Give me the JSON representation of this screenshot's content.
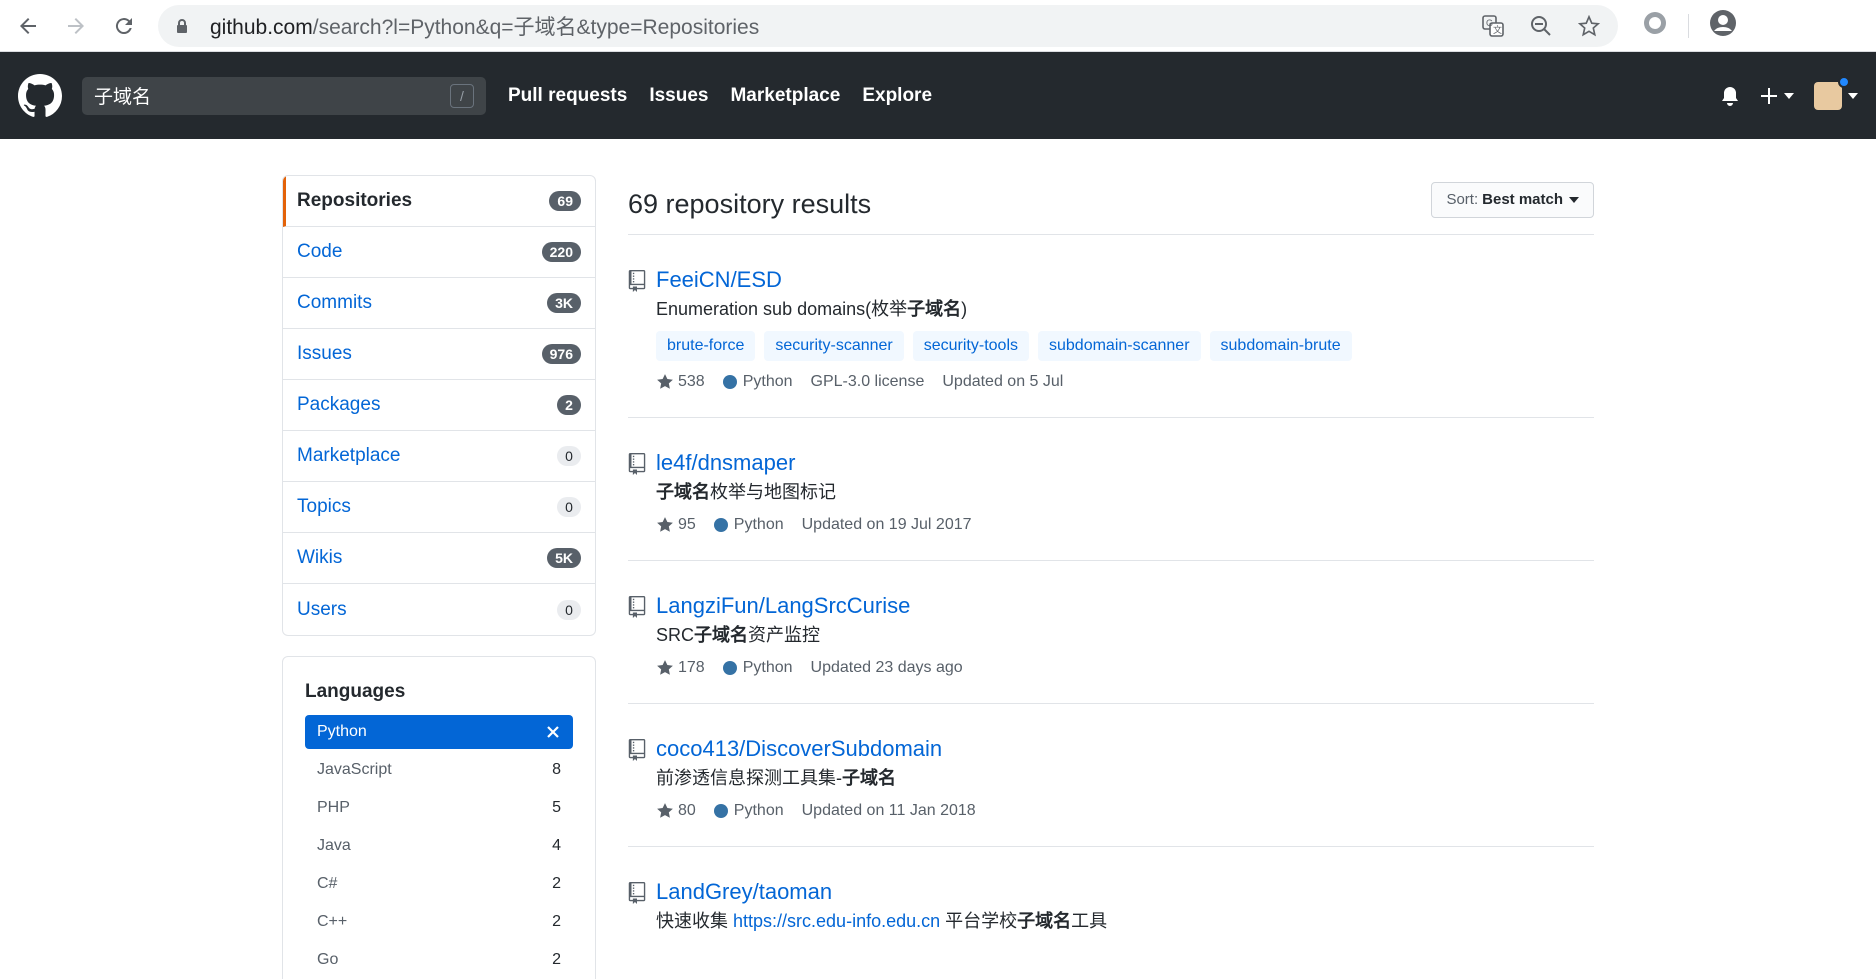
{
  "browser": {
    "url_host": "github.com",
    "url_rest": "/search?l=Python&q=子域名&type=Repositories"
  },
  "header": {
    "search_value": "子域名",
    "search_shortcut": "/",
    "nav": [
      "Pull requests",
      "Issues",
      "Marketplace",
      "Explore"
    ]
  },
  "sidebar": {
    "filters": [
      {
        "label": "Repositories",
        "count": "69"
      },
      {
        "label": "Code",
        "count": "220"
      },
      {
        "label": "Commits",
        "count": "3K"
      },
      {
        "label": "Issues",
        "count": "976"
      },
      {
        "label": "Packages",
        "count": "2"
      },
      {
        "label": "Marketplace",
        "count": "0"
      },
      {
        "label": "Topics",
        "count": "0"
      },
      {
        "label": "Wikis",
        "count": "5K"
      },
      {
        "label": "Users",
        "count": "0"
      }
    ],
    "languages_title": "Languages",
    "languages": [
      {
        "name": "Python",
        "count": ""
      },
      {
        "name": "JavaScript",
        "count": "8"
      },
      {
        "name": "PHP",
        "count": "5"
      },
      {
        "name": "Java",
        "count": "4"
      },
      {
        "name": "C#",
        "count": "2"
      },
      {
        "name": "C++",
        "count": "2"
      },
      {
        "name": "Go",
        "count": "2"
      }
    ]
  },
  "results": {
    "title": "69 repository results",
    "sort_prefix": "Sort:",
    "sort_value": "Best match",
    "repos": [
      {
        "name": "FeeiCN/ESD",
        "desc_pre": "Enumeration sub domains(枚举",
        "desc_bold": "子域名",
        "desc_post": ")",
        "topics": [
          "brute-force",
          "security-scanner",
          "security-tools",
          "subdomain-scanner",
          "subdomain-brute"
        ],
        "stars": "538",
        "language": "Python",
        "license": "GPL-3.0 license",
        "updated": "Updated on 5 Jul"
      },
      {
        "name": "le4f/dnsmaper",
        "desc_pre": "",
        "desc_bold": "子域名",
        "desc_post": "枚举与地图标记",
        "stars": "95",
        "language": "Python",
        "updated": "Updated on 19 Jul 2017"
      },
      {
        "name": "LangziFun/LangSrcCurise",
        "desc_pre": "SRC",
        "desc_bold": "子域名",
        "desc_post": "资产监控",
        "stars": "178",
        "language": "Python",
        "updated": "Updated 23 days ago"
      },
      {
        "name": "coco413/DiscoverSubdomain",
        "desc_pre": "前渗透信息探测工具集-",
        "desc_bold": "子域名",
        "desc_post": "",
        "stars": "80",
        "language": "Python",
        "updated": "Updated on 11 Jan 2018"
      },
      {
        "name": "LandGrey/taoman",
        "desc_pre": "快速收集 ",
        "desc_link": "https://src.edu-info.edu.cn",
        "desc_mid": " 平台学校",
        "desc_bold": "子域名",
        "desc_post": "工具"
      }
    ]
  }
}
